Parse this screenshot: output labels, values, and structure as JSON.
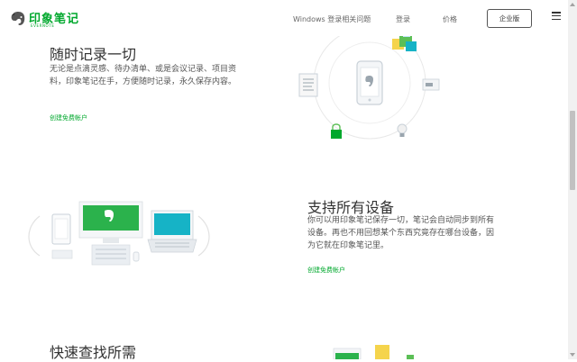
{
  "header": {
    "logo_text": "印象笔记",
    "logo_sub": "EVERNOTE",
    "nav": [
      {
        "label": "Windows 登录相关问题"
      },
      {
        "label": "登录"
      },
      {
        "label": "价格"
      }
    ],
    "enterprise_label": "企业版"
  },
  "sections": [
    {
      "title": "随时记录一切",
      "desc": "无论是点滴灵感、待办清单、或是会议记录、项目资料，印象笔记在手，方便随时记录，永久保存内容。",
      "link": "创建免费帐户"
    },
    {
      "title": "支持所有设备",
      "desc": "你可以用印象笔记保存一切，笔记会自动同步到所有设备。再也不用回想某个东西究竟存在哪台设备，因为它就在印象笔记里。",
      "link": "创建免费帐户"
    },
    {
      "title": "快速查找所需"
    }
  ],
  "colors": {
    "brand_green": "#00a82d",
    "teal": "#16b3c6",
    "yellow": "#f5d44c"
  }
}
